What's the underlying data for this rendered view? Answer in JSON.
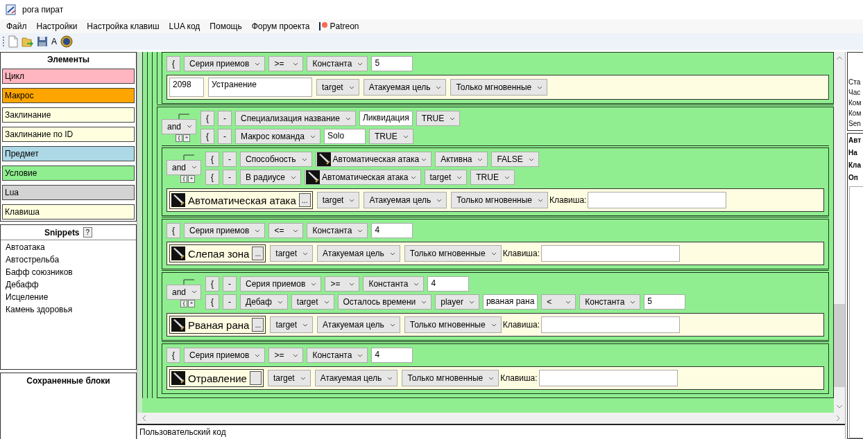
{
  "window": {
    "title": "рога пират"
  },
  "menu": [
    {
      "kind": "text",
      "label": "Файл"
    },
    {
      "kind": "text",
      "label": "Настройки"
    },
    {
      "kind": "text",
      "label": "Настройка клавиш"
    },
    {
      "kind": "text",
      "label": "LUA код"
    },
    {
      "kind": "text",
      "label": "Помощь"
    },
    {
      "kind": "text",
      "label": "Форум проекта"
    },
    {
      "kind": "patreon",
      "label": "Patreon"
    }
  ],
  "toolbar": {
    "font_button": "A"
  },
  "elements": {
    "title": "Элементы",
    "items": [
      {
        "label": "Цикл",
        "color": "#ffb6c1"
      },
      {
        "label": "Макрос",
        "color": "#ffa500"
      },
      {
        "label": "Заклинание",
        "color": "#ffffe0"
      },
      {
        "label": "Заклинание по ID",
        "color": "#ffffe0"
      },
      {
        "label": "Предмет",
        "color": "#add8e6"
      },
      {
        "label": "Условие",
        "color": "#90ee90"
      },
      {
        "label": "Lua",
        "color": "#d3d3d3"
      },
      {
        "label": "Клавиша",
        "color": "#ffffe0"
      }
    ]
  },
  "snippets": {
    "title": "Snippets",
    "help": "?",
    "items": [
      "Автоатака",
      "Автострельба",
      "Бафф союзников",
      "Дебафф",
      "Исцеление",
      "Камень здоровья"
    ]
  },
  "saved_blocks": {
    "title": "Сохраненные блоки"
  },
  "editor": {
    "blocks": [
      {
        "children": [
          {
            "children": [
              {
                "children": [
                  {
                    "children": [
                      {
                        "conditions": {
                          "rows": [
                            {
                              "tokens": [
                                {
                                  "kind": "brace",
                                  "text": "{"
                                },
                                {
                                  "kind": "select",
                                  "text": "Серия приемов"
                                },
                                {
                                  "kind": "select",
                                  "text": ">="
                                },
                                {
                                  "kind": "select",
                                  "text": "Константа"
                                },
                                {
                                  "kind": "input",
                                  "value": "5"
                                }
                              ]
                            }
                          ]
                        },
                        "action": {
                          "kind": "id",
                          "id": "2098",
                          "name": "Устранение",
                          "selects": [
                            "target",
                            "Атакуемая цель",
                            "Только мгновенные"
                          ]
                        }
                      }
                    ]
                  },
                  {
                    "conditions": {
                      "logic": {
                        "value": "and",
                        "buttons": [
                          "{",
                          "+"
                        ]
                      },
                      "rows": [
                        {
                          "tokens": [
                            {
                              "kind": "brace",
                              "text": "{"
                            },
                            {
                              "kind": "minus",
                              "text": "-"
                            },
                            {
                              "kind": "select",
                              "text": "Специализация название"
                            },
                            {
                              "kind": "input",
                              "value": "Ликвидация"
                            },
                            {
                              "kind": "select",
                              "text": "TRUE"
                            }
                          ]
                        },
                        {
                          "tokens": [
                            {
                              "kind": "brace",
                              "text": "{"
                            },
                            {
                              "kind": "minus",
                              "text": "-"
                            },
                            {
                              "kind": "select",
                              "text": "Макрос команда"
                            },
                            {
                              "kind": "input",
                              "value": "Solo"
                            },
                            {
                              "kind": "select",
                              "text": "TRUE"
                            }
                          ]
                        }
                      ]
                    },
                    "children": [
                      {
                        "conditions": {
                          "logic": {
                            "value": "and",
                            "buttons": [
                              "{",
                              "+"
                            ]
                          },
                          "rows": [
                            {
                              "tokens": [
                                {
                                  "kind": "brace",
                                  "text": "{"
                                },
                                {
                                  "kind": "minus",
                                  "text": "-"
                                },
                                {
                                  "kind": "select",
                                  "text": "Способность"
                                },
                                {
                                  "kind": "spell-select",
                                  "text": "Автоматическая атака"
                                },
                                {
                                  "kind": "select",
                                  "text": "Активна"
                                },
                                {
                                  "kind": "select",
                                  "text": "FALSE"
                                }
                              ]
                            },
                            {
                              "tokens": [
                                {
                                  "kind": "brace",
                                  "text": "{"
                                },
                                {
                                  "kind": "minus",
                                  "text": "-"
                                },
                                {
                                  "kind": "select",
                                  "text": "В радиусе"
                                },
                                {
                                  "kind": "spell-select",
                                  "text": "Автоматическая атака"
                                },
                                {
                                  "kind": "select",
                                  "text": "target"
                                },
                                {
                                  "kind": "select",
                                  "text": "TRUE"
                                }
                              ]
                            }
                          ]
                        },
                        "action": {
                          "kind": "spell",
                          "name": "Автоматическая атака",
                          "more": "...",
                          "selects": [
                            "target",
                            "Атакуемая цель",
                            "Только мгновенные"
                          ],
                          "key_label": "Клавиша:"
                        }
                      },
                      {
                        "conditions": {
                          "rows": [
                            {
                              "tokens": [
                                {
                                  "kind": "brace",
                                  "text": "{"
                                },
                                {
                                  "kind": "select",
                                  "text": "Серия приемов"
                                },
                                {
                                  "kind": "select",
                                  "text": "<="
                                },
                                {
                                  "kind": "select",
                                  "text": "Константа"
                                },
                                {
                                  "kind": "input",
                                  "value": "4"
                                }
                              ]
                            }
                          ]
                        },
                        "action": {
                          "kind": "spell",
                          "name": "Слепая зона",
                          "more": "...",
                          "selects": [
                            "target",
                            "Атакуемая цель",
                            "Только мгновенные"
                          ],
                          "key_label": "Клавиша:"
                        }
                      },
                      {
                        "conditions": {
                          "logic": {
                            "value": "and",
                            "buttons": [
                              "{",
                              "+"
                            ]
                          },
                          "rows": [
                            {
                              "tokens": [
                                {
                                  "kind": "brace",
                                  "text": "{"
                                },
                                {
                                  "kind": "minus",
                                  "text": "-"
                                },
                                {
                                  "kind": "select",
                                  "text": "Серия приемов"
                                },
                                {
                                  "kind": "select",
                                  "text": ">="
                                },
                                {
                                  "kind": "select",
                                  "text": "Константа"
                                },
                                {
                                  "kind": "input",
                                  "value": "4"
                                }
                              ]
                            },
                            {
                              "tokens": [
                                {
                                  "kind": "brace",
                                  "text": "{"
                                },
                                {
                                  "kind": "minus",
                                  "text": "-"
                                },
                                {
                                  "kind": "select",
                                  "text": "Дебаф"
                                },
                                {
                                  "kind": "select",
                                  "text": "target"
                                },
                                {
                                  "kind": "select",
                                  "text": "Осталось времени"
                                },
                                {
                                  "kind": "select",
                                  "text": "player"
                                },
                                {
                                  "kind": "input",
                                  "value": "рваная рана"
                                },
                                {
                                  "kind": "select",
                                  "text": "<"
                                },
                                {
                                  "kind": "select",
                                  "text": "Константа"
                                },
                                {
                                  "kind": "input",
                                  "value": "5"
                                }
                              ]
                            }
                          ]
                        },
                        "action": {
                          "kind": "spell",
                          "name": "Рваная рана",
                          "more": "...",
                          "selects": [
                            "target",
                            "Атакуемая цель",
                            "Только мгновенные"
                          ],
                          "key_label": "Клавиша:"
                        }
                      },
                      {
                        "conditions": {
                          "rows": [
                            {
                              "tokens": [
                                {
                                  "kind": "brace",
                                  "text": "{"
                                },
                                {
                                  "kind": "select",
                                  "text": "Серия приемов"
                                },
                                {
                                  "kind": "select",
                                  "text": ">="
                                },
                                {
                                  "kind": "select",
                                  "text": "Константа"
                                },
                                {
                                  "kind": "input",
                                  "value": "4"
                                }
                              ]
                            }
                          ]
                        },
                        "action": {
                          "kind": "spell",
                          "name": "Отравление",
                          "selects": [
                            "target",
                            "Атакуемая цель",
                            "Только мгновенные"
                          ],
                          "key_label": "Клавиша:"
                        }
                      }
                    ]
                  }
                ]
              }
            ]
          }
        ]
      }
    ]
  },
  "custom_code": {
    "label": "Пользовательский код"
  },
  "right_panel": {
    "info_lines": [
      "Ста",
      "Час",
      "Ком",
      "Ком",
      "Sen"
    ],
    "fields": [
      "Авт",
      "На",
      "Кла",
      "Оп"
    ]
  }
}
